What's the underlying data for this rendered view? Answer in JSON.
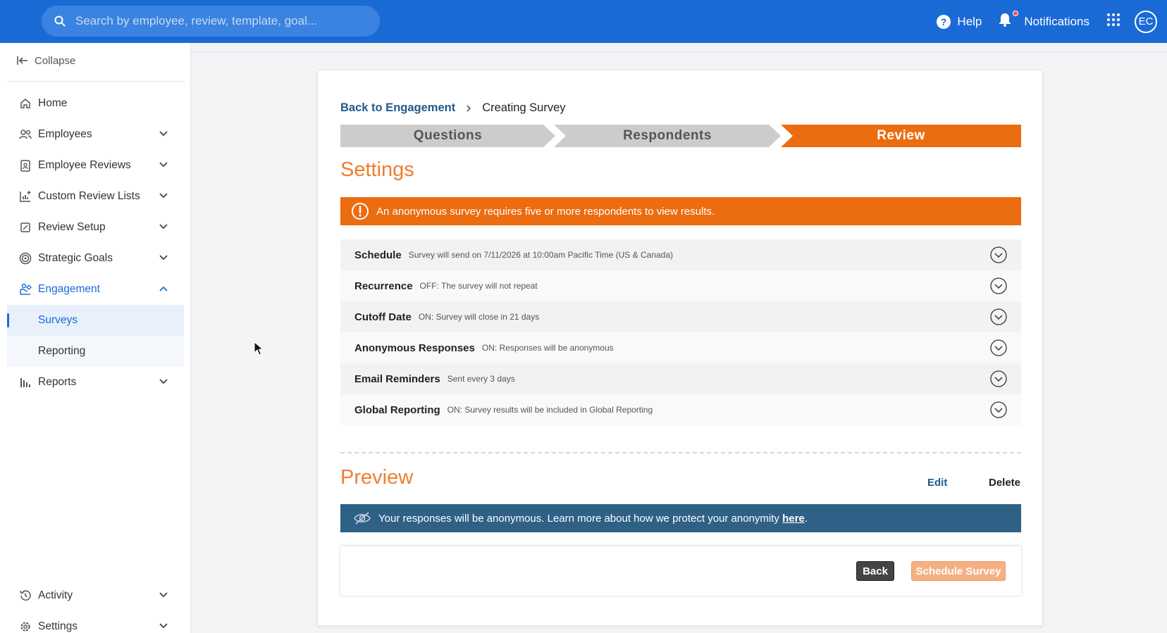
{
  "search": {
    "placeholder": "Search by employee, review, template, goal..."
  },
  "header": {
    "help_label": "Help",
    "notifications_label": "Notifications",
    "avatar_initials": "EC"
  },
  "sidebar": {
    "collapse_label": "Collapse",
    "items": [
      {
        "label": "Home",
        "icon": "home-icon"
      },
      {
        "label": "Employees",
        "icon": "people-icon"
      },
      {
        "label": "Employee Reviews",
        "icon": "clipboard-icon"
      },
      {
        "label": "Custom Review Lists",
        "icon": "chart-add-icon"
      },
      {
        "label": "Review Setup",
        "icon": "edit-doc-icon"
      },
      {
        "label": "Strategic Goals",
        "icon": "target-icon"
      },
      {
        "label": "Engagement",
        "icon": "engagement-icon"
      },
      {
        "label": "Reports",
        "icon": "bar-chart-icon"
      },
      {
        "label": "Activity",
        "icon": "history-icon"
      },
      {
        "label": "Settings",
        "icon": "gear-icon"
      }
    ],
    "sub_items": [
      {
        "label": "Surveys"
      },
      {
        "label": "Reporting"
      }
    ]
  },
  "breadcrumb": {
    "back_label": "Back to Engagement",
    "current": "Creating Survey"
  },
  "steps": [
    {
      "label": "Questions"
    },
    {
      "label": "Respondents"
    },
    {
      "label": "Review"
    }
  ],
  "settings_section": {
    "title": "Settings",
    "warning": "An anonymous survey requires five or more respondents to view results.",
    "rows": [
      {
        "label": "Schedule",
        "desc": "Survey will send on 7/11/2026 at 10:00am Pacific Time (US & Canada)"
      },
      {
        "label": "Recurrence",
        "desc": "OFF: The survey will not repeat"
      },
      {
        "label": "Cutoff Date",
        "desc": "ON: Survey will close in 21 days"
      },
      {
        "label": "Anonymous Responses",
        "desc": "ON: Responses will be anonymous"
      },
      {
        "label": "Email Reminders",
        "desc": "Sent every 3 days"
      },
      {
        "label": "Global Reporting",
        "desc": "ON: Survey results will be included in Global Reporting"
      }
    ]
  },
  "preview_section": {
    "title": "Preview",
    "edit_label": "Edit",
    "delete_label": "Delete",
    "anon_text": "Your responses will be anonymous. Learn more about how we protect your anonymity ",
    "anon_link": "here",
    "anon_end": "."
  },
  "buttons": {
    "back": "Back",
    "schedule": "Schedule Survey"
  },
  "colors": {
    "topbar": "#1a6ad6",
    "accent_orange": "#ec6c10",
    "anon_banner": "#2f6086",
    "link": "#1f5a8c"
  }
}
